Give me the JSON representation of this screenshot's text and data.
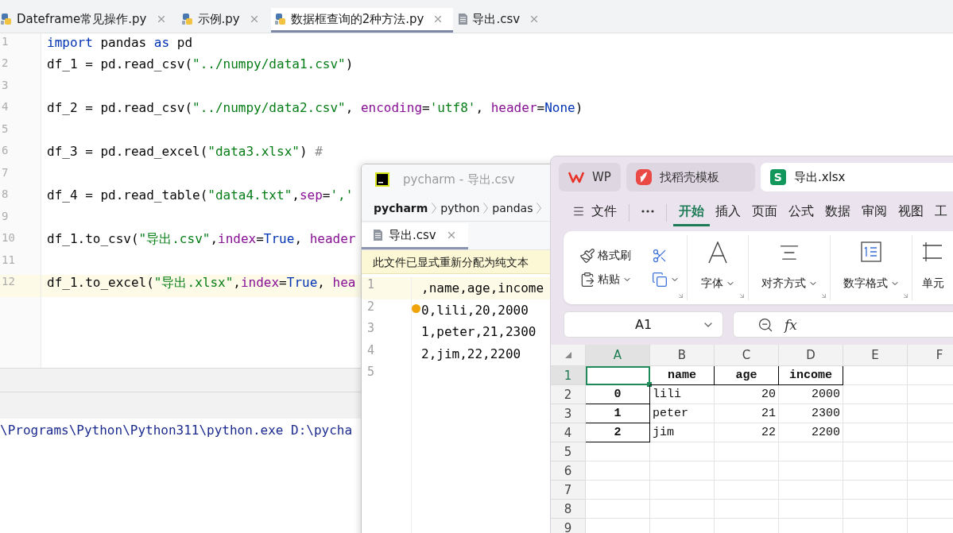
{
  "editor_tabs": [
    {
      "label": "Dateframe常见操作.py",
      "kind": "python",
      "selected": false
    },
    {
      "label": "示例.py",
      "kind": "python",
      "selected": false
    },
    {
      "label": "数据框查询的2种方法.py",
      "kind": "python",
      "selected": true
    },
    {
      "label": "导出.csv",
      "kind": "text",
      "selected": false
    }
  ],
  "code_lines": [
    {
      "number": "1",
      "current": false,
      "tokens": [
        {
          "kind": "kw",
          "text": "import"
        },
        {
          "kind": "plain",
          "text": " pandas "
        },
        {
          "kind": "kw",
          "text": "as"
        },
        {
          "kind": "plain",
          "text": " pd"
        }
      ]
    },
    {
      "number": "2",
      "current": false,
      "tokens": [
        {
          "kind": "plain",
          "text": "df_1 = pd.read_csv("
        },
        {
          "kind": "str",
          "text": "\"../numpy/data1.csv\""
        },
        {
          "kind": "plain",
          "text": ")"
        }
      ]
    },
    {
      "number": "3",
      "current": false
    },
    {
      "number": "4",
      "current": false,
      "tokens": [
        {
          "kind": "plain",
          "text": "df_2 = pd.read_csv("
        },
        {
          "kind": "str",
          "text": "\"../numpy/data2.csv\""
        },
        {
          "kind": "plain",
          "text": ", "
        },
        {
          "kind": "param",
          "text": "encoding"
        },
        {
          "kind": "plain",
          "text": "="
        },
        {
          "kind": "str",
          "text": "'utf8'"
        },
        {
          "kind": "plain",
          "text": ", "
        },
        {
          "kind": "param",
          "text": "header"
        },
        {
          "kind": "plain",
          "text": "="
        },
        {
          "kind": "kw",
          "text": "None"
        },
        {
          "kind": "plain",
          "text": ")"
        }
      ]
    },
    {
      "number": "5",
      "current": false
    },
    {
      "number": "6",
      "current": false,
      "tokens": [
        {
          "kind": "plain",
          "text": "df_3 = pd.read_excel("
        },
        {
          "kind": "str",
          "text": "\"data3.xlsx\""
        },
        {
          "kind": "plain",
          "text": ") "
        },
        {
          "kind": "comment",
          "text": "#"
        }
      ]
    },
    {
      "number": "7",
      "current": false
    },
    {
      "number": "8",
      "current": false,
      "tokens": [
        {
          "kind": "plain",
          "text": "df_4 = pd.read_table("
        },
        {
          "kind": "str",
          "text": "\"data4.txt\""
        },
        {
          "kind": "plain",
          "text": ","
        },
        {
          "kind": "param",
          "text": "sep"
        },
        {
          "kind": "plain",
          "text": "="
        },
        {
          "kind": "str",
          "text": "','"
        }
      ]
    },
    {
      "number": "9",
      "current": false
    },
    {
      "number": "10",
      "current": false,
      "tokens": [
        {
          "kind": "plain",
          "text": "df_1.to_csv("
        },
        {
          "kind": "str",
          "text": "\"导出.csv\""
        },
        {
          "kind": "plain",
          "text": ","
        },
        {
          "kind": "param",
          "text": "index"
        },
        {
          "kind": "plain",
          "text": "="
        },
        {
          "kind": "kw",
          "text": "True"
        },
        {
          "kind": "plain",
          "text": ", "
        },
        {
          "kind": "param",
          "text": "header"
        }
      ]
    },
    {
      "number": "11",
      "current": false
    },
    {
      "number": "12",
      "current": true,
      "tokens": [
        {
          "kind": "plain",
          "text": "df_1.to_excel("
        },
        {
          "kind": "str",
          "text": "\"导出.xlsx\""
        },
        {
          "kind": "plain",
          "text": ","
        },
        {
          "kind": "param",
          "text": "index"
        },
        {
          "kind": "plain",
          "text": "="
        },
        {
          "kind": "kw",
          "text": "True"
        },
        {
          "kind": "plain",
          "text": ", "
        },
        {
          "kind": "param",
          "text": "hea"
        }
      ]
    }
  ],
  "console": {
    "output": "\\Programs\\Python\\Python311\\python.exe D:\\pycha"
  },
  "csv_window": {
    "title": "pycharm - 导出.csv",
    "breadcrumbs": [
      "pycharm",
      "python",
      "pandas"
    ],
    "tab": {
      "label": "导出.csv",
      "selected": true
    },
    "notice": "此文件已显式重新分配为纯文本",
    "lines": [
      {
        "number": "1",
        "text": ",name,age,income",
        "current": true
      },
      {
        "number": "2",
        "text": "0,lili,20,2000",
        "current": false
      },
      {
        "number": "3",
        "text": "1,peter,21,2300",
        "current": false
      },
      {
        "number": "4",
        "text": "2,jim,22,2200",
        "current": false
      },
      {
        "number": "5",
        "current": false
      }
    ]
  },
  "wps": {
    "tabs": [
      {
        "label": "WP",
        "kind": "wps",
        "selected": false
      },
      {
        "label": "找稻壳模板",
        "kind": "docer",
        "selected": false
      },
      {
        "label": "导出.xlsx",
        "kind": "sheet",
        "badge": "S",
        "selected": true
      }
    ],
    "menu": [
      {
        "label": "文件",
        "kind": "file",
        "selected": false
      },
      {
        "kind": "more",
        "selected": false
      },
      {
        "label": "开始",
        "kind": "tab",
        "selected": true
      },
      {
        "label": "插入",
        "kind": "tab",
        "selected": false
      },
      {
        "label": "页面",
        "kind": "tab",
        "selected": false
      },
      {
        "label": "公式",
        "kind": "tab",
        "selected": false
      },
      {
        "label": "数据",
        "kind": "tab",
        "selected": false
      },
      {
        "label": "审阅",
        "kind": "tab",
        "selected": false
      },
      {
        "label": "视图",
        "kind": "tab",
        "selected": false
      },
      {
        "label": "工",
        "kind": "tab",
        "selected": false
      }
    ],
    "ribbon": [
      {
        "kind": "clipboard",
        "painter": "格式刷",
        "paste": "粘贴"
      },
      {
        "kind": "font",
        "label": "字体"
      },
      {
        "kind": "align",
        "label": "对齐方式"
      },
      {
        "kind": "number",
        "label": "数字格式"
      },
      {
        "kind": "cell",
        "label": "单元"
      }
    ],
    "name_box": "A1",
    "formula_label": "fx",
    "sheet": {
      "columns": [
        {
          "label": "A",
          "selected": true
        },
        {
          "label": "B",
          "selected": false
        },
        {
          "label": "C",
          "selected": false
        },
        {
          "label": "D",
          "selected": false
        },
        {
          "label": "E",
          "selected": false
        },
        {
          "label": "F",
          "selected": false
        }
      ],
      "rows": [
        {
          "label": "1",
          "kind": "header",
          "selected": true,
          "cells": [
            "name",
            "age",
            "income"
          ]
        },
        {
          "label": "2",
          "kind": "record",
          "selected": false,
          "index": "0",
          "cells": [
            "lili",
            "20",
            "2000"
          ]
        },
        {
          "label": "3",
          "kind": "record",
          "selected": false,
          "index": "1",
          "cells": [
            "peter",
            "21",
            "2300"
          ]
        },
        {
          "label": "4",
          "kind": "record",
          "selected": false,
          "index": "2",
          "cells": [
            "jim",
            "22",
            "2200"
          ]
        },
        {
          "label": "5",
          "kind": "empty",
          "selected": false
        },
        {
          "label": "6",
          "kind": "empty",
          "selected": false
        },
        {
          "label": "7",
          "kind": "empty",
          "selected": false
        },
        {
          "label": "8",
          "kind": "empty",
          "selected": false
        },
        {
          "label": "9",
          "kind": "empty",
          "selected": false
        }
      ]
    }
  }
}
